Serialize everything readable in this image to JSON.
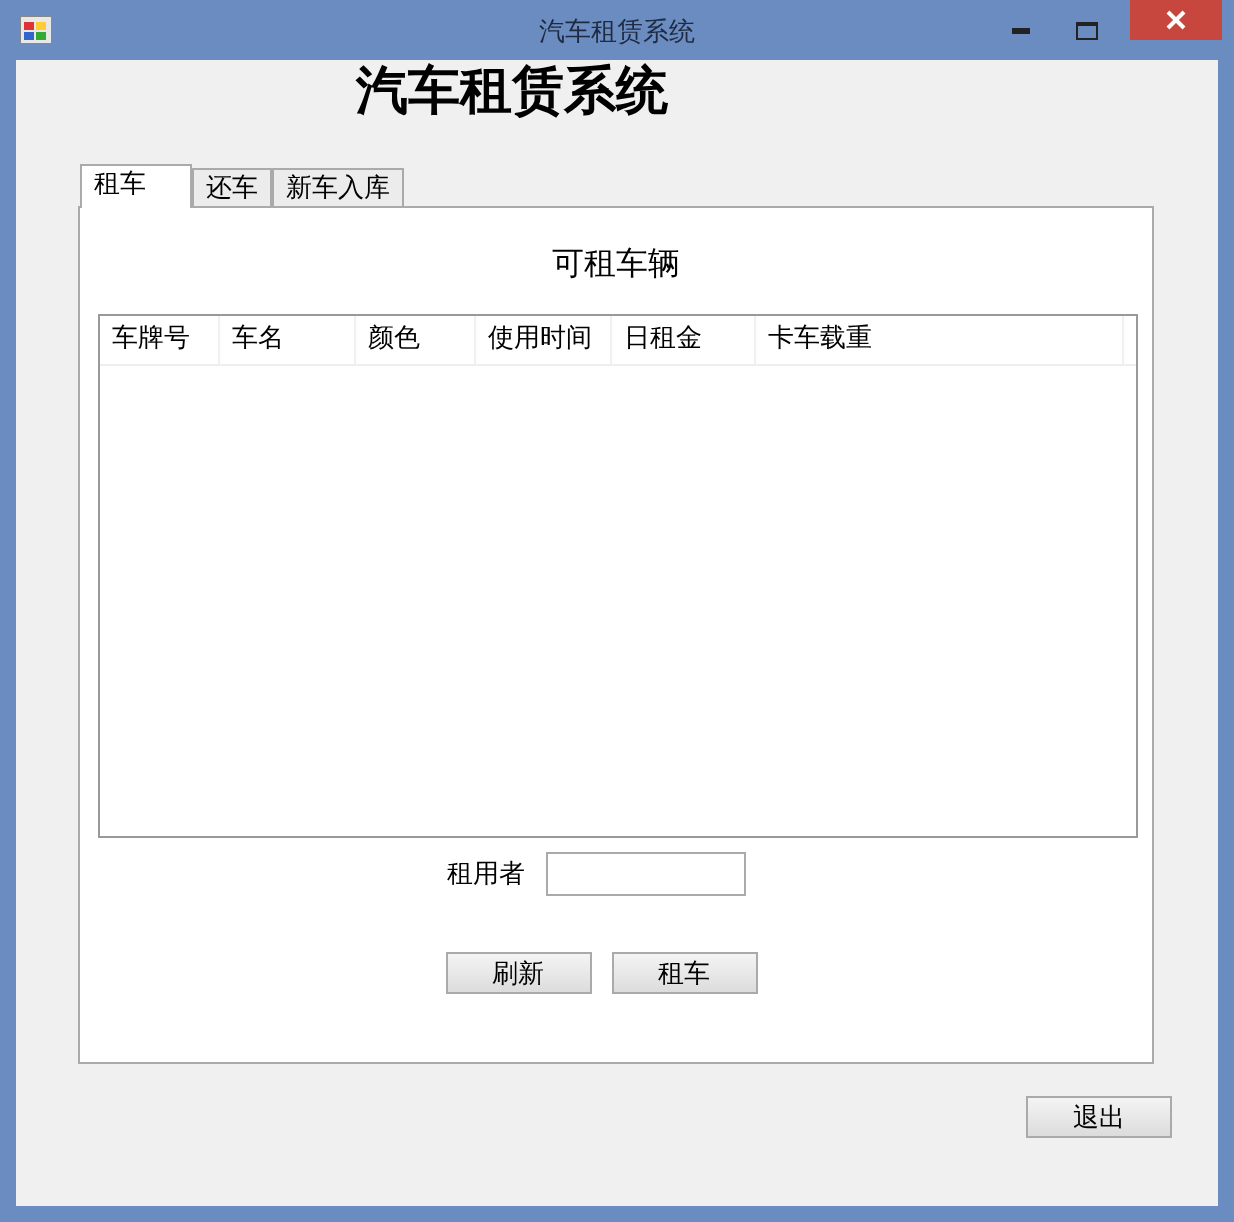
{
  "window": {
    "title": "汽车租赁系统"
  },
  "heading": "汽车租赁系统",
  "tabs": [
    {
      "label": "租车",
      "selected": true
    },
    {
      "label": "还车",
      "selected": false
    },
    {
      "label": "新车入库",
      "selected": false
    }
  ],
  "panel_title": "可租车辆",
  "table": {
    "columns": [
      "车牌号",
      "车名",
      "颜色",
      "使用时间",
      "日租金",
      "卡车载重"
    ]
  },
  "renter": {
    "label": "租用者"
  },
  "buttons": [
    "刷新",
    "租车"
  ],
  "exit_button": "退出"
}
